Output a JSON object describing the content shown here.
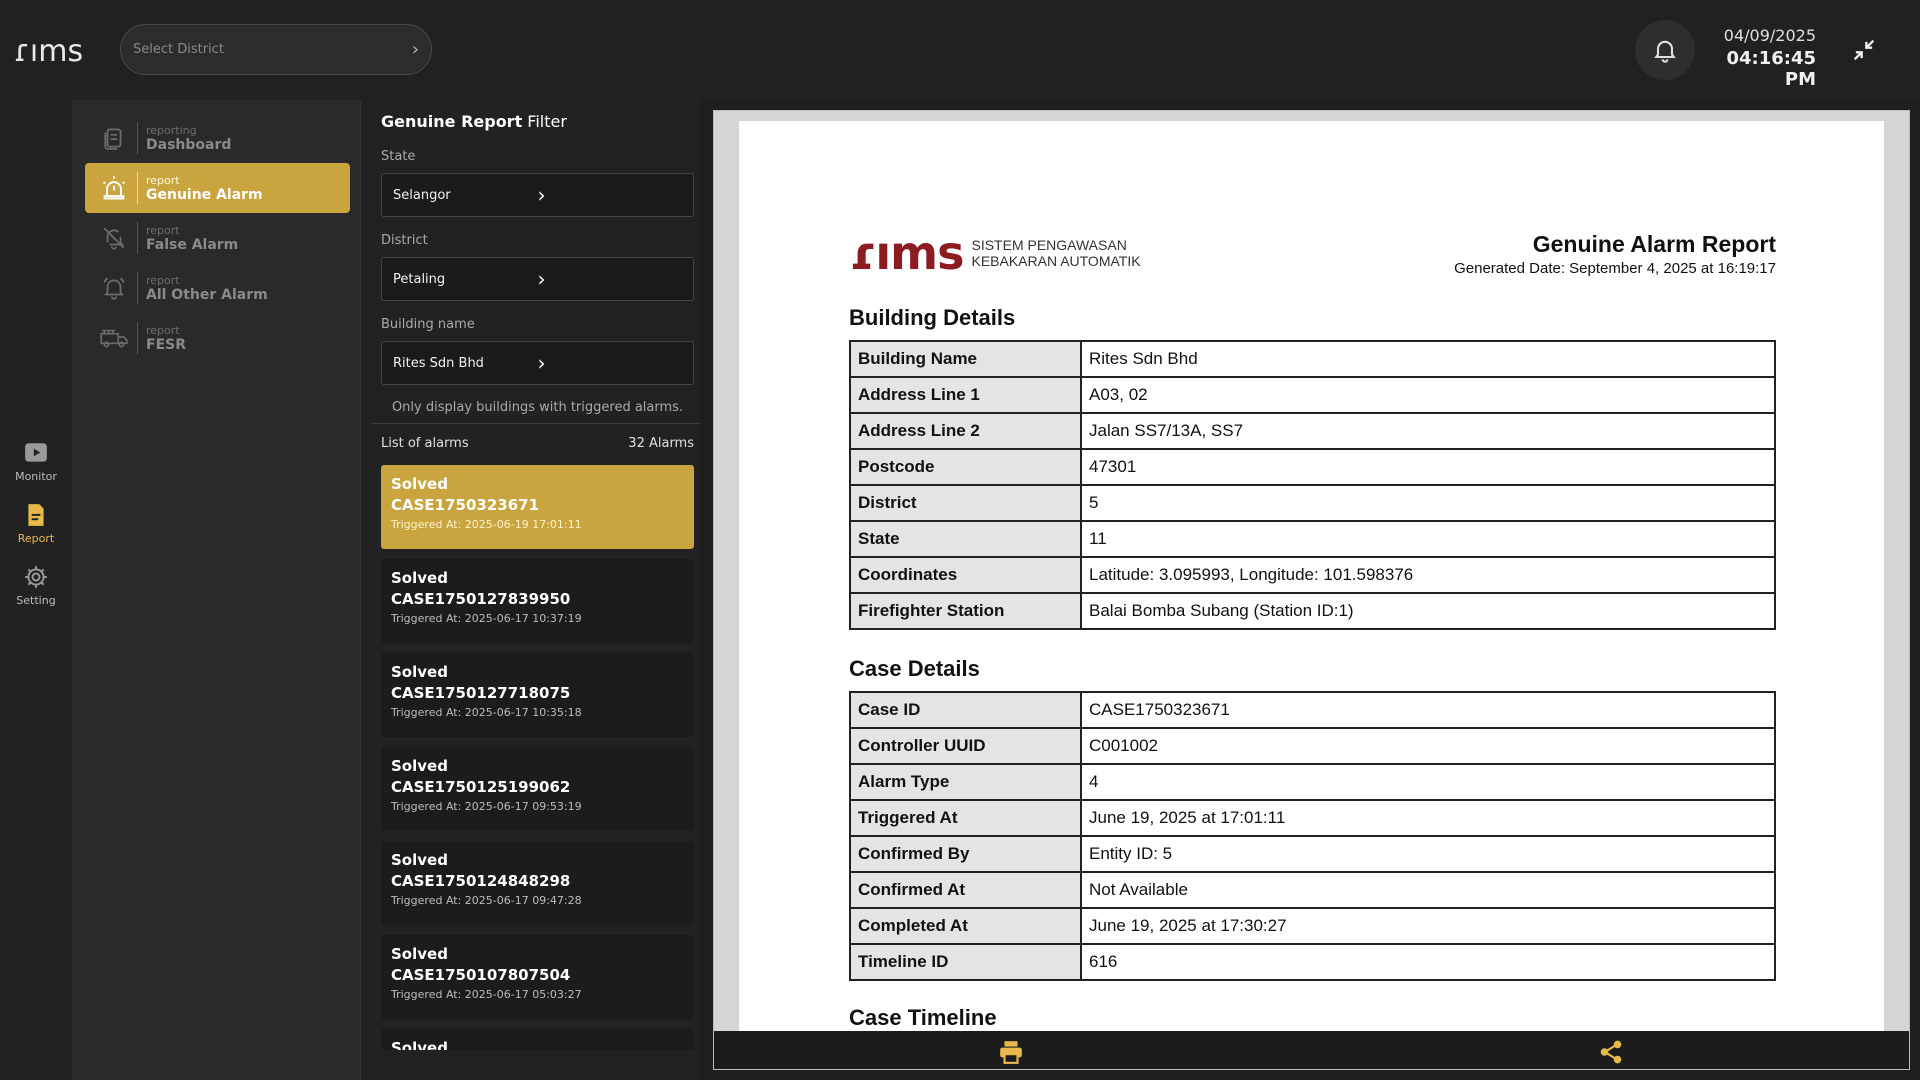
{
  "topbar": {
    "logo": "ɾıms",
    "district_placeholder": "Select District",
    "date": "04/09/2025",
    "time": "04:16:45 PM"
  },
  "rail": [
    {
      "label": "Monitor",
      "icon": "play-icon"
    },
    {
      "label": "Report",
      "icon": "report-icon"
    },
    {
      "label": "Setting",
      "icon": "gear-icon"
    }
  ],
  "submenu": [
    {
      "sub": "reporting",
      "label": "Dashboard",
      "icon": "document-icon"
    },
    {
      "sub": "report",
      "label": "Genuine Alarm",
      "icon": "alarm-siren-icon"
    },
    {
      "sub": "report",
      "label": "False Alarm",
      "icon": "bell-off-icon"
    },
    {
      "sub": "report",
      "label": "All Other Alarm",
      "icon": "bell-ring-icon"
    },
    {
      "sub": "report",
      "label": "FESR",
      "icon": "fire-truck-icon"
    }
  ],
  "filter": {
    "title_bold": "Genuine Report",
    "title_rest": " Filter",
    "state_label": "State",
    "state_value": "Selangor",
    "district_label": "District",
    "district_value": "Petaling",
    "building_label": "Building name",
    "building_value": "Rites Sdn Bhd",
    "hint": "Only display buildings with triggered alarms.",
    "list_label": "List of alarms",
    "count": "32 Alarms"
  },
  "alarms": [
    {
      "status": "Solved",
      "case": "CASE1750323671",
      "triggered": "Triggered At: 2025-06-19 17:01:11"
    },
    {
      "status": "Solved",
      "case": "CASE1750127839950",
      "triggered": "Triggered At: 2025-06-17 10:37:19"
    },
    {
      "status": "Solved",
      "case": "CASE1750127718075",
      "triggered": "Triggered At: 2025-06-17 10:35:18"
    },
    {
      "status": "Solved",
      "case": "CASE1750125199062",
      "triggered": "Triggered At: 2025-06-17 09:53:19"
    },
    {
      "status": "Solved",
      "case": "CASE1750124848298",
      "triggered": "Triggered At: 2025-06-17 09:47:28"
    },
    {
      "status": "Solved",
      "case": "CASE1750107807504",
      "triggered": "Triggered At: 2025-06-17 05:03:27"
    },
    {
      "status": "Solved",
      "case": "",
      "triggered": ""
    }
  ],
  "report": {
    "brand_mark": "ɾıms",
    "brand_line1": "SISTEM PENGAWASAN",
    "brand_line2": "KEBAKARAN AUTOMATIK",
    "title": "Genuine Alarm Report",
    "generated": "Generated Date: September 4, 2025 at 16:19:17",
    "building_title": "Building Details",
    "building_rows": [
      [
        "Building Name",
        "Rites Sdn Bhd"
      ],
      [
        "Address Line 1",
        "A03, 02"
      ],
      [
        "Address Line 2",
        "Jalan SS7/13A, SS7"
      ],
      [
        "Postcode",
        "47301"
      ],
      [
        "District",
        "5"
      ],
      [
        "State",
        "11"
      ],
      [
        "Coordinates",
        "Latitude: 3.095993, Longitude: 101.598376"
      ],
      [
        "Firefighter Station",
        "Balai Bomba Subang (Station ID:1)"
      ]
    ],
    "case_title": "Case Details",
    "case_rows": [
      [
        "Case ID",
        "CASE1750323671"
      ],
      [
        "Controller UUID",
        "C001002"
      ],
      [
        "Alarm Type",
        "4"
      ],
      [
        "Triggered At",
        "June 19, 2025 at 17:01:11"
      ],
      [
        "Confirmed By",
        "Entity ID: 5"
      ],
      [
        "Confirmed At",
        "Not Available"
      ],
      [
        "Completed At",
        "June 19, 2025 at 17:30:27"
      ],
      [
        "Timeline ID",
        "616"
      ]
    ],
    "timeline_title": "Case Timeline"
  },
  "colors": {
    "accent": "#c9a43f",
    "brand": "#8c1c22"
  }
}
